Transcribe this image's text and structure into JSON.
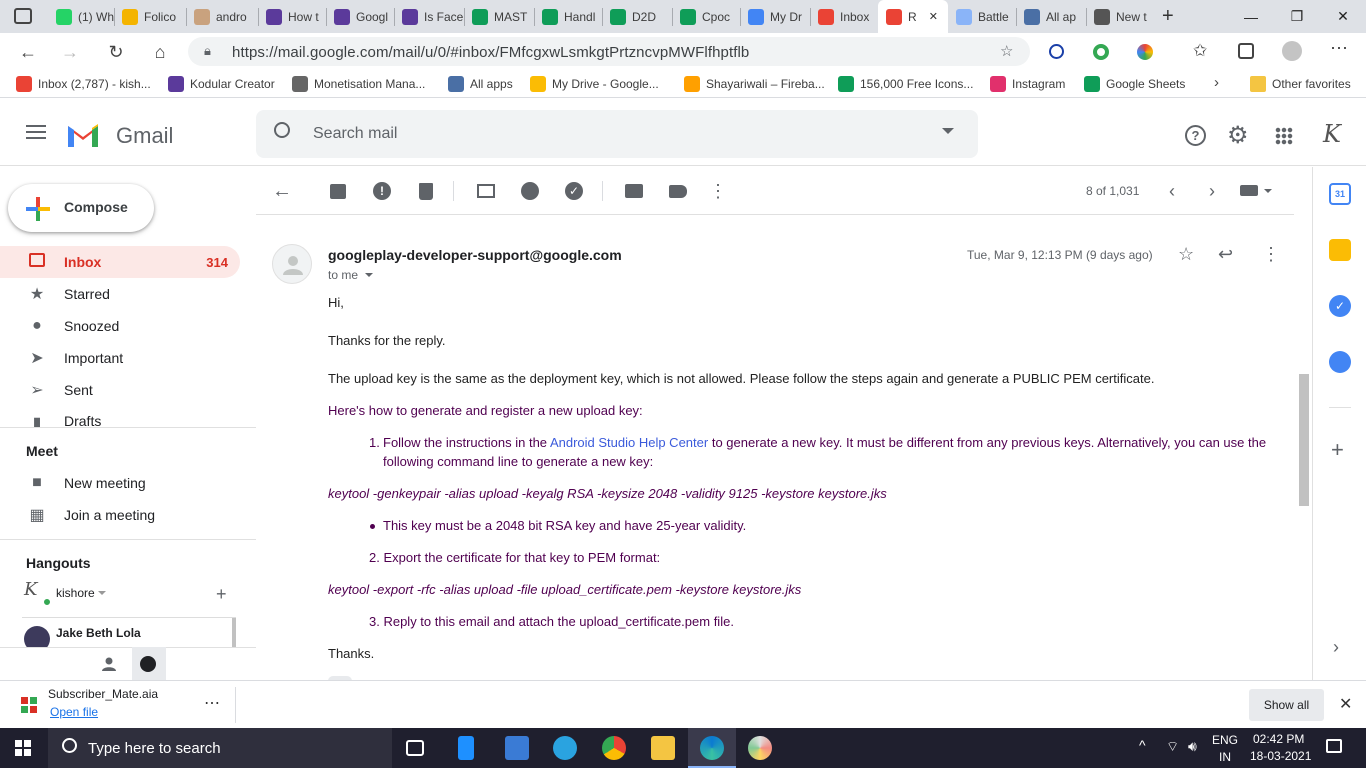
{
  "browser": {
    "tabs": [
      {
        "label": "(1) Wh",
        "color": "#25d366"
      },
      {
        "label": "Folico",
        "color": "#f4b400"
      },
      {
        "label": "andro",
        "color": "#c9a27e"
      },
      {
        "label": "How t",
        "color": "#5b3a9b"
      },
      {
        "label": "Googl",
        "color": "#5b3a9b"
      },
      {
        "label": "Is Face",
        "color": "#5b3a9b"
      },
      {
        "label": "MAST",
        "color": "#0f9d58"
      },
      {
        "label": "Handl",
        "color": "#0f9d58"
      },
      {
        "label": "D2D",
        "color": "#0f9d58"
      },
      {
        "label": "Cpoc",
        "color": "#0f9d58"
      },
      {
        "label": "My Dr",
        "color": "#4285f4"
      },
      {
        "label": "Inbox",
        "color": "#ea4335"
      },
      {
        "label": "R",
        "color": "#ea4335"
      },
      {
        "label": "Battle",
        "color": "#8ab4f8"
      },
      {
        "label": "All ap",
        "color": "#4a6fa5"
      },
      {
        "label": "New t",
        "color": "#555555"
      }
    ],
    "url": "https://mail.google.com/mail/u/0/#inbox/FMfcgxwLsmkgtPrtzncvpMWFlfhptflb",
    "bookmarks": [
      {
        "label": "Inbox (2,787) - kish...",
        "color": "#ea4335"
      },
      {
        "label": "Kodular Creator",
        "color": "#5b3a9b"
      },
      {
        "label": "Monetisation Mana...",
        "color": "#666666"
      },
      {
        "label": "All apps",
        "color": "#4a6fa5"
      },
      {
        "label": "My Drive - Google...",
        "color": "#fbbc04"
      },
      {
        "label": "Shayariwali – Fireba...",
        "color": "#ffa000"
      },
      {
        "label": "156,000 Free Icons...",
        "color": "#0f9d58"
      },
      {
        "label": "Instagram",
        "color": "#e1306c"
      },
      {
        "label": "Google Sheets",
        "color": "#0f9d58"
      }
    ],
    "other_favorites": "Other favorites"
  },
  "gmail": {
    "logo_text": "Gmail",
    "search_placeholder": "Search mail",
    "compose_label": "Compose",
    "nav": [
      {
        "label": "Inbox",
        "count": "314",
        "icon": "inbox-icon"
      },
      {
        "label": "Starred",
        "count": "",
        "icon": "star-icon"
      },
      {
        "label": "Snoozed",
        "count": "",
        "icon": "clock-icon"
      },
      {
        "label": "Important",
        "count": "",
        "icon": "important-icon"
      },
      {
        "label": "Sent",
        "count": "",
        "icon": "send-icon"
      },
      {
        "label": "Drafts",
        "count": "",
        "icon": "draft-icon"
      }
    ],
    "meet_title": "Meet",
    "meet_items": [
      "New meeting",
      "Join a meeting"
    ],
    "hangouts_title": "Hangouts",
    "hangouts_user": "kishore",
    "hangouts_contact": "Jake Beth Lola",
    "pagination": "8 of 1,031",
    "email": {
      "sender": "googleplay-developer-support@google.com",
      "to": "to me",
      "date": "Tue, Mar 9, 12:13 PM (9 days ago)",
      "greeting": "Hi,",
      "thanks_reply": "Thanks for the reply.",
      "para1": "The upload key is the same as the deployment key, which is not allowed. Please follow the steps again and generate a PUBLIC PEM certificate.",
      "howto": "Here's how to generate and register a new upload key:",
      "step1_num": "1.",
      "step1_pre": "Follow the instructions in the",
      "step1_link": "Android Studio Help Center",
      "step1_post": "to generate a new key. It must be different from any previous keys. Alternatively, you can use the",
      "step1_line2": "following command line to generate a new key:",
      "cmd1": "keytool -genkeypair -alias upload -keyalg RSA -keysize 2048 -validity 9125 -keystore keystore.jks",
      "bullet": "This key must be a 2048 bit RSA key and have 25-year validity.",
      "step2": "2. Export the certificate for that key to PEM format:",
      "cmd2": "keytool -export -rfc -alias upload -file upload_certificate.pem -keystore keystore.jks",
      "step3": "3. Reply to this email and attach the upload_certificate.pem file.",
      "signoff": "Thanks."
    }
  },
  "download": {
    "file": "Subscriber_Mate.aia",
    "action": "Open file",
    "show_all": "Show all"
  },
  "taskbar": {
    "search_placeholder": "Type here to search",
    "lang_top": "ENG",
    "lang_bottom": "IN",
    "time": "02:42 PM",
    "date": "18-03-2021"
  }
}
